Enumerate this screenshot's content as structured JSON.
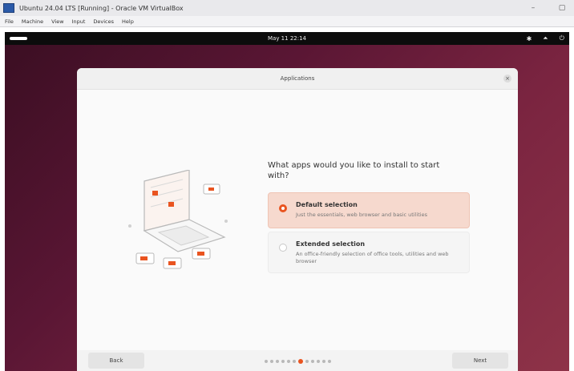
{
  "window": {
    "title": "Ubuntu 24.04 LTS [Running] - Oracle VM VirtualBox",
    "menu": [
      "File",
      "Machine",
      "View",
      "Input",
      "Devices",
      "Help"
    ]
  },
  "topbar": {
    "clock": "May 11 22:14"
  },
  "dialog": {
    "title": "Applications",
    "question": "What apps would you like to install to start with?",
    "options": [
      {
        "title": "Default selection",
        "description": "Just the essentials, web browser and basic utilities",
        "selected": true
      },
      {
        "title": "Extended selection",
        "description": "An office-friendly selection of office tools, utilities and web browser",
        "selected": false
      }
    ],
    "back_label": "Back",
    "next_label": "Next",
    "pager": {
      "total": 12,
      "current": 7
    }
  },
  "colors": {
    "accent": "#e95420",
    "selected_bg": "#f6d9ce",
    "desktop": "#6a1c3a"
  }
}
